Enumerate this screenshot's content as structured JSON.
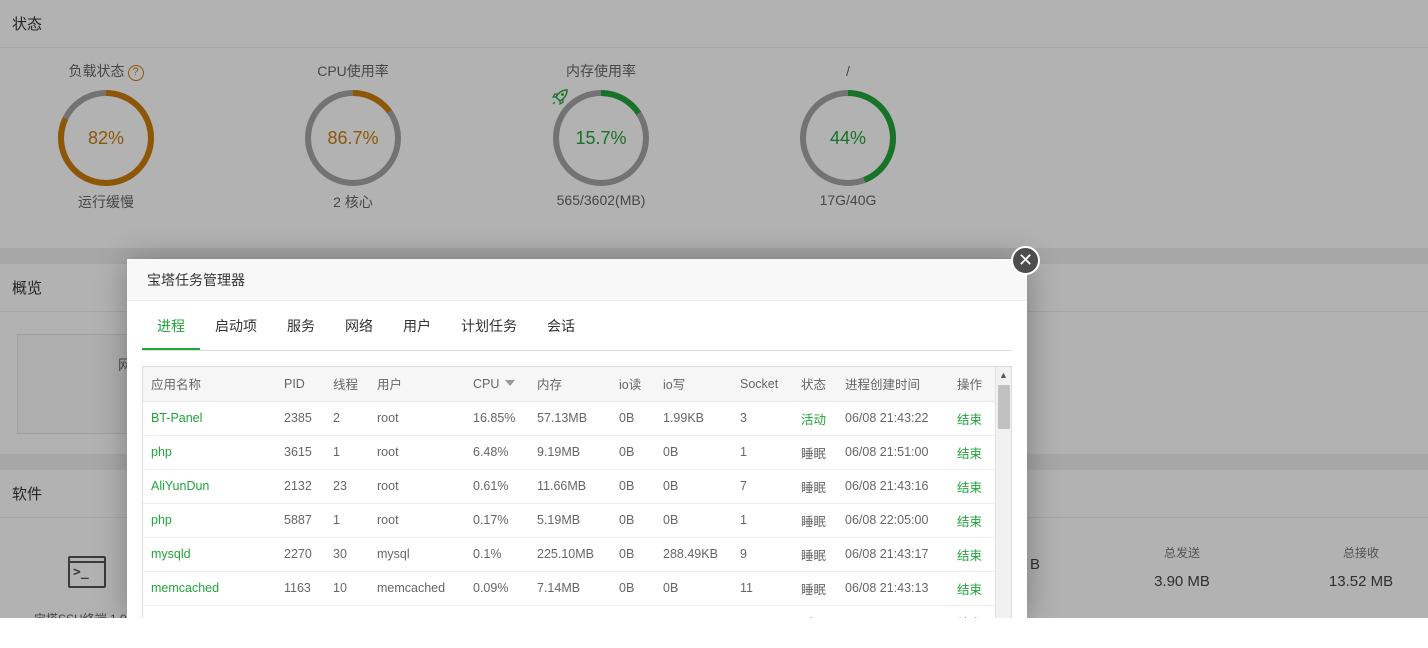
{
  "status_panel": {
    "title": "状态",
    "gauges": [
      {
        "title": "负载状态",
        "value": "82%",
        "sub": "运行缓慢",
        "percent": 82,
        "color": "#cb7d0b",
        "help": "?"
      },
      {
        "title": "CPU使用率",
        "value": "86.7%",
        "sub": "2 核心",
        "percent": 15,
        "color": "#cb7d0b"
      },
      {
        "title": "内存使用率",
        "value": "15.7%",
        "sub": "565/3602(MB)",
        "percent": 15.7,
        "color": "#20a53a",
        "icon": "rocket-icon"
      },
      {
        "title": "/",
        "value": "44%",
        "sub": "17G/40G",
        "percent": 44,
        "color": "#20a53a"
      }
    ]
  },
  "overview_panel": {
    "title": "概览",
    "partial_label": "网"
  },
  "software_panel": {
    "title": "软件",
    "app_label": "宝塔SSH终端 1.0",
    "stats": [
      {
        "label": "",
        "value": "B"
      },
      {
        "label": "总发送",
        "value": "3.90 MB"
      },
      {
        "label": "总接收",
        "value": "13.52 MB"
      }
    ]
  },
  "dialog": {
    "title": "宝塔任务管理器",
    "close_label": "✕",
    "tabs": [
      "进程",
      "启动项",
      "服务",
      "网络",
      "用户",
      "计划任务",
      "会话"
    ],
    "active_tab": 0,
    "columns": [
      "应用名称",
      "PID",
      "线程",
      "用户",
      "CPU",
      "内存",
      "io读",
      "io写",
      "Socket",
      "状态",
      "进程创建时间",
      "操作"
    ],
    "rows": [
      [
        "BT-Panel",
        "2385",
        "2",
        "root",
        "16.85%",
        "57.13MB",
        "0B",
        "1.99KB",
        "3",
        "活动",
        "06/08 21:43:22",
        "结束"
      ],
      [
        "php",
        "3615",
        "1",
        "root",
        "6.48%",
        "9.19MB",
        "0B",
        "0B",
        "1",
        "睡眠",
        "06/08 21:51:00",
        "结束"
      ],
      [
        "AliYunDun",
        "2132",
        "23",
        "root",
        "0.61%",
        "11.66MB",
        "0B",
        "0B",
        "7",
        "睡眠",
        "06/08 21:43:16",
        "结束"
      ],
      [
        "php",
        "5887",
        "1",
        "root",
        "0.17%",
        "5.19MB",
        "0B",
        "0B",
        "1",
        "睡眠",
        "06/08 22:05:00",
        "结束"
      ],
      [
        "mysqld",
        "2270",
        "30",
        "mysql",
        "0.1%",
        "225.10MB",
        "0B",
        "288.49KB",
        "9",
        "睡眠",
        "06/08 21:43:17",
        "结束"
      ],
      [
        "memcached",
        "1163",
        "10",
        "memcached",
        "0.09%",
        "7.14MB",
        "0B",
        "0B",
        "11",
        "睡眠",
        "06/08 21:43:13",
        "结束"
      ],
      [
        "",
        "",
        "",
        "",
        "",
        "",
        "",
        "",
        "",
        "睡眠",
        "",
        "结束"
      ]
    ]
  }
}
